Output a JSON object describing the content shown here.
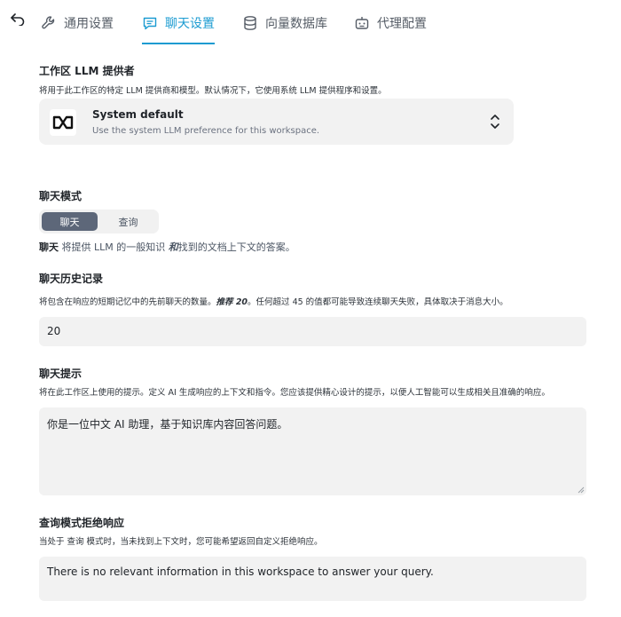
{
  "tabs": [
    {
      "label": "通用设置",
      "icon": "wrench-icon",
      "active": false
    },
    {
      "label": "聊天设置",
      "icon": "chat-icon",
      "active": true
    },
    {
      "label": "向量数据库",
      "icon": "database-icon",
      "active": false
    },
    {
      "label": "代理配置",
      "icon": "robot-icon",
      "active": false
    }
  ],
  "llm_provider": {
    "title": "工作区 LLM 提供者",
    "description": "将用于此工作区的特定 LLM 提供商和模型。默认情况下，它使用系统 LLM 提供程序和设置。",
    "selected_name": "System default",
    "selected_sub": "Use the system LLM preference for this workspace."
  },
  "chat_mode": {
    "title": "聊天模式",
    "options": [
      "聊天",
      "查询"
    ],
    "selected": "聊天",
    "desc_bold": "聊天",
    "desc_1": " 将提供 LLM 的一般知识 ",
    "desc_em": "和",
    "desc_2": "找到的文档上下文的答案。"
  },
  "history": {
    "title": "聊天历史记录",
    "desc_1": "将包含在响应的短期记忆中的先前聊天的数量。",
    "desc_em": "推荐 20",
    "desc_2": "。任何超过 45 的值都可能导致连续聊天失败，具体取决于消息大小。",
    "value": "20"
  },
  "prompt": {
    "title": "聊天提示",
    "description": "将在此工作区上使用的提示。定义 AI 生成响应的上下文和指令。您应该提供精心设计的提示，以便人工智能可以生成相关且准确的响应。",
    "value": "你是一位中文 AI 助理，基于知识库内容回答问题。"
  },
  "refusal": {
    "title": "查询模式拒绝响应",
    "description": "当处于 查询 模式时，当未找到上下文时，您可能希望返回自定义拒绝响应。",
    "value": "There is no relevant information in this workspace to answer your query."
  },
  "colors": {
    "accent": "#1b9bd1",
    "field_bg": "#f2f2f2",
    "segment_on": "#5d6779"
  }
}
